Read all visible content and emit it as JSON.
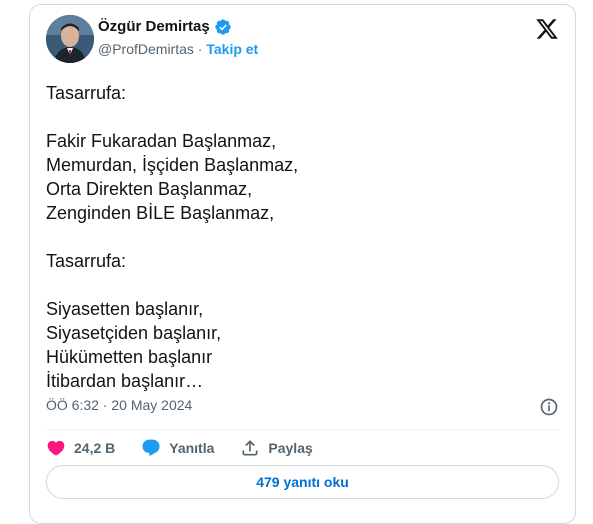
{
  "author": {
    "name": "Özgür Demirtaş",
    "handle": "@ProfDemirtas",
    "separator": "·",
    "follow_label": "Takip et",
    "verified_icon": "verified-badge-icon",
    "avatar_icon": "avatar-photo"
  },
  "brand": {
    "logo_icon": "x-logo-icon"
  },
  "tweet": {
    "text": "Tasarrufa:\n\nFakir Fukaradan Başlanmaz,\nMemurdan, İşçiden Başlanmaz,\nOrta Direkten Başlanmaz,\nZenginden BİLE Başlanmaz,\n\nTasarrufa:\n\nSiyasetten başlanır,\nSiyasetçiden başlanır,\nHükümetten başlanır\nİtibardan başlanır…",
    "timestamp": "ÖÖ 6:32 · 20 May 2024",
    "info_icon": "info-icon"
  },
  "actions": {
    "like_count": "24,2 B",
    "like_icon": "heart-icon",
    "reply_label": "Yanıtla",
    "reply_icon": "reply-bubble-icon",
    "share_label": "Paylaş",
    "share_icon": "share-icon"
  },
  "replies_button": {
    "label": "479 yanıtı oku"
  },
  "colors": {
    "accent": "#1d9bf0",
    "like": "#f91880",
    "reply": "#1d9bf0",
    "muted": "#536471",
    "border": "#cfd9de"
  }
}
